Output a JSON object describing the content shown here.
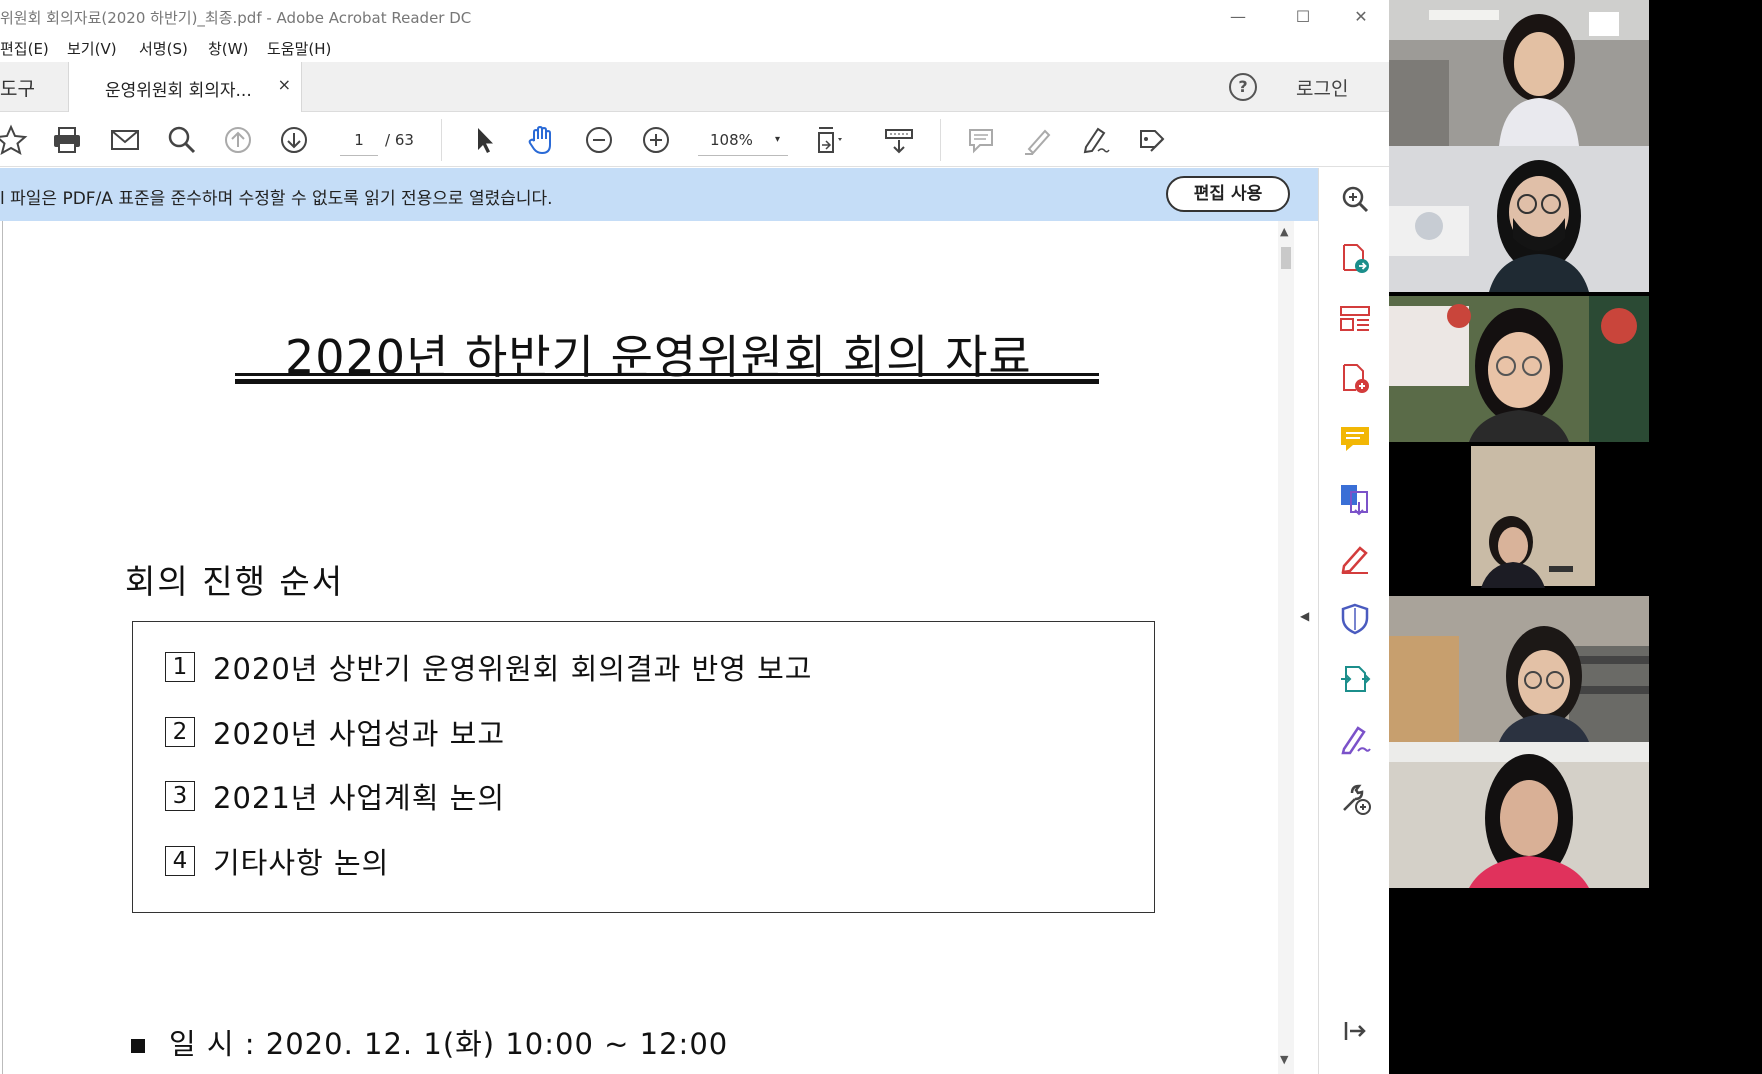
{
  "window": {
    "title": "위원회 회의자료(2020 하반기)_최종.pdf - Adobe Acrobat Reader DC",
    "minimize": "—",
    "maximize": "☐",
    "close": "✕"
  },
  "menu": {
    "items": [
      "편집(E)",
      "보기(V)",
      "서명(S)",
      "창(W)",
      "도움말(H)"
    ]
  },
  "tabs": {
    "tools_label": "도구",
    "doc_tab_label": "운영위원회 회의자...",
    "doc_tab_close": "×",
    "help_label": "?",
    "login_label": "로그인"
  },
  "toolbar": {
    "page_current": "1",
    "page_total": "/ 63",
    "zoom": "108%",
    "zoom_caret": "▾"
  },
  "infobar": {
    "message": "l 파일은 PDF/A 표준을 준수하며 수정할 수 없도록 읽기 전용으로 열렸습니다.",
    "edit_button": "편집 사용"
  },
  "document": {
    "title": "2020년 하반기 운영위원회 회의 자료",
    "section_heading": "회의 진행 순서",
    "agenda": [
      {
        "num": "1",
        "text": "2020년 상반기 운영위원회 회의결과 반영 보고"
      },
      {
        "num": "2",
        "text": "2020년 사업성과 보고"
      },
      {
        "num": "3",
        "text": "2021년 사업계획 논의"
      },
      {
        "num": "4",
        "text": "기타사항 논의"
      }
    ],
    "date_line": "일  시 : 2020. 12. 1(화) 10:00 ~ 12:00"
  },
  "scroll": {
    "up": "▲",
    "down": "▼"
  },
  "collapse_arrow": "◀",
  "right_pane_icons": [
    "zoom-search-icon",
    "export-pdf-icon",
    "organize-pages-icon",
    "create-pdf-icon",
    "comment-icon",
    "convert-pdf-icon",
    "fill-sign-icon",
    "protect-icon",
    "send-pdf-icon",
    "sign-icon",
    "more-tools-icon",
    "expand-panel-icon"
  ],
  "participants": [
    {
      "name": "participant-1",
      "shirt_color": "#e9e9ee",
      "hair_color": "#1a1412",
      "bg": "#9d9b97"
    },
    {
      "name": "participant-2",
      "shirt_color": "#1f2a33",
      "hair_color": "#111111",
      "bg": "#d8d9dc"
    },
    {
      "name": "participant-3",
      "shirt_color": "#2a2a2a",
      "hair_color": "#141010",
      "bg": "#5a6b48"
    },
    {
      "name": "participant-4",
      "shirt_color": "#1c1c24",
      "hair_color": "#1b1614",
      "bg": "#c9bba6"
    },
    {
      "name": "participant-5",
      "shirt_color": "#2b3240",
      "hair_color": "#1c1816",
      "bg": "#a9a39a"
    },
    {
      "name": "participant-6",
      "shirt_color": "#e0325c",
      "hair_color": "#121010",
      "bg": "#d4d0c8"
    }
  ],
  "colors": {
    "infobar": "#c5ddf7",
    "accent_teal": "#1b8e8b",
    "accent_blue": "#3a6fd6",
    "accent_red": "#d33c3c"
  }
}
